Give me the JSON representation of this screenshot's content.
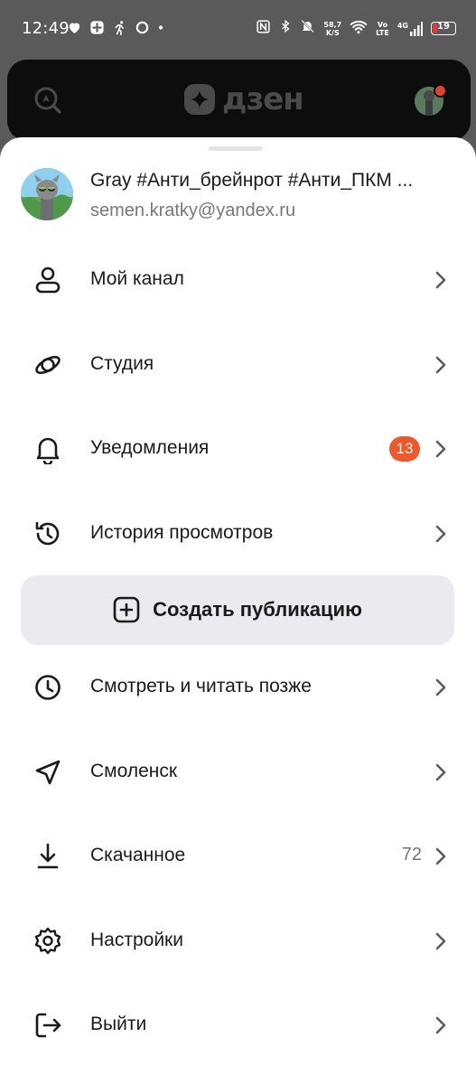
{
  "status_bar": {
    "time": "12:49",
    "network_speed_value": "58,7",
    "network_speed_unit": "K/S",
    "volte_top": "Vo",
    "volte_bottom": "LTE",
    "signal_type": "4G",
    "battery_level": "19",
    "battery_fraction": 0.19
  },
  "app_header": {
    "logo_text": "дзен"
  },
  "profile": {
    "name": "Gray #Анти_брейнрот #Анти_ПКМ ...",
    "email": "semen.kratky@yandex.ru"
  },
  "menu": {
    "my_channel": "Мой канал",
    "studio": "Студия",
    "notifications": "Уведомления",
    "notifications_badge": "13",
    "history": "История просмотров",
    "create_publication": "Создать публикацию",
    "watch_later": "Смотреть и читать позже",
    "location": "Смоленск",
    "downloads": "Скачанное",
    "downloads_count": "72",
    "settings": "Настройки",
    "logout": "Выйти"
  },
  "colors": {
    "badge": "#f0582a",
    "accent_dot": "#e0442c",
    "create_button_bg": "#ebebef",
    "secondary_text": "#77777c"
  }
}
